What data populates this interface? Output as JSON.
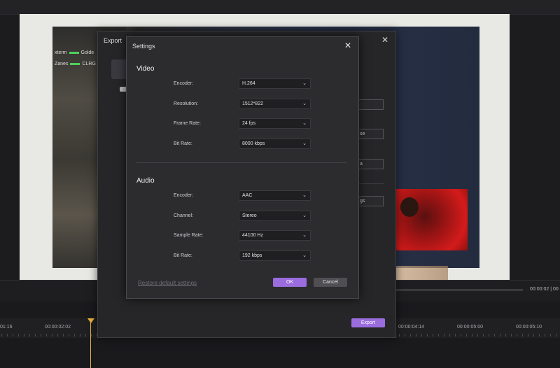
{
  "preview": {
    "hud_players": [
      {
        "name": "xterm",
        "tag": "Golde"
      },
      {
        "name": "Zanes",
        "tag": "CLRG"
      }
    ]
  },
  "timeline": {
    "timecode": "00:00:02 | 00",
    "ruler_labels": [
      "01:16",
      "00:00:02:02",
      "00:00:04:14",
      "00:00:05:00",
      "00:00:05:10"
    ]
  },
  "export_dialog": {
    "title": "Export",
    "partial_fields": [
      "se",
      "a",
      "gs"
    ],
    "export_label": "Export"
  },
  "settings": {
    "title": "Settings",
    "video": {
      "title": "Video",
      "fields": [
        {
          "label": "Encoder:",
          "value": "H.264"
        },
        {
          "label": "Resolution:",
          "value": "1512*822"
        },
        {
          "label": "Frame Rate:",
          "value": "24 fps"
        },
        {
          "label": "Bit Rate:",
          "value": "8000 kbps"
        }
      ]
    },
    "audio": {
      "title": "Audio",
      "fields": [
        {
          "label": "Encoder:",
          "value": "AAC"
        },
        {
          "label": "Channel:",
          "value": "Stereo"
        },
        {
          "label": "Sample Rate:",
          "value": "44100 Hz"
        },
        {
          "label": "Bit Rate:",
          "value": "192 kbps"
        }
      ]
    },
    "restore_label": "Restore default settings",
    "ok_label": "OK",
    "cancel_label": "Cancel"
  },
  "icons": {
    "close": "close-icon",
    "chevron": "chevron-down-icon"
  },
  "colors": {
    "accent": "#9a6cde",
    "playhead": "#e8b23a"
  }
}
